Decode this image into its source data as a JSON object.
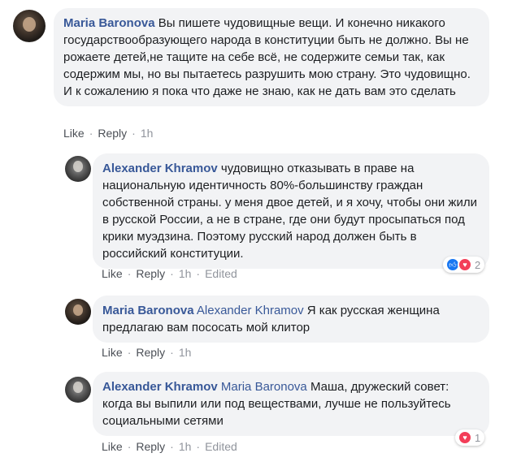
{
  "comments": [
    {
      "author": "Maria Baronova",
      "mention": "",
      "text": "Вы пишете чудовищные вещи. И конечно никакого государствообразующего народа в конституции быть не должно. Вы не рожаете детей,не тащите на себе всё, не содержите семьи так, как содержим мы, но вы пытаетесь разрушить мою страну. Это чудовищно. И к сожалению я пока что даже не знаю, как не дать вам это сделать",
      "actions": {
        "like": "Like",
        "reply": "Reply",
        "time": "1h",
        "edited": ""
      }
    },
    {
      "author": "Alexander Khramov",
      "mention": "",
      "text": "чудовищно отказывать в праве на национальную идентичность 80%-большинству граждан собственной страны. у меня двое детей, и я хочу, чтобы они жили в русской России, а не в стране, где они будут просыпаться под крики муэдзина. Поэтому русский народ должен быть в российский конституции.",
      "actions": {
        "like": "Like",
        "reply": "Reply",
        "time": "1h",
        "edited": "Edited"
      },
      "reactions": {
        "count": "2",
        "types": [
          "like-icon",
          "love-icon"
        ]
      }
    },
    {
      "author": "Maria Baronova",
      "mention": "Alexander Khramov",
      "text": "Я как русская женщина предлагаю вам пососать мой клитор",
      "actions": {
        "like": "Like",
        "reply": "Reply",
        "time": "1h",
        "edited": ""
      }
    },
    {
      "author": "Alexander Khramov",
      "mention": "Maria Baronova",
      "text": "Маша, дружеский совет: когда вы выпили или под веществами, лучше не пользуйтесь социальными сетями",
      "actions": {
        "like": "Like",
        "reply": "Reply",
        "time": "1h",
        "edited": "Edited"
      },
      "reactions": {
        "count": "1",
        "types": [
          "love-icon"
        ]
      }
    }
  ],
  "colors": {
    "author": "#385898",
    "bubble": "#f2f3f5",
    "like": "#1877f2",
    "love": "#f33e58"
  }
}
